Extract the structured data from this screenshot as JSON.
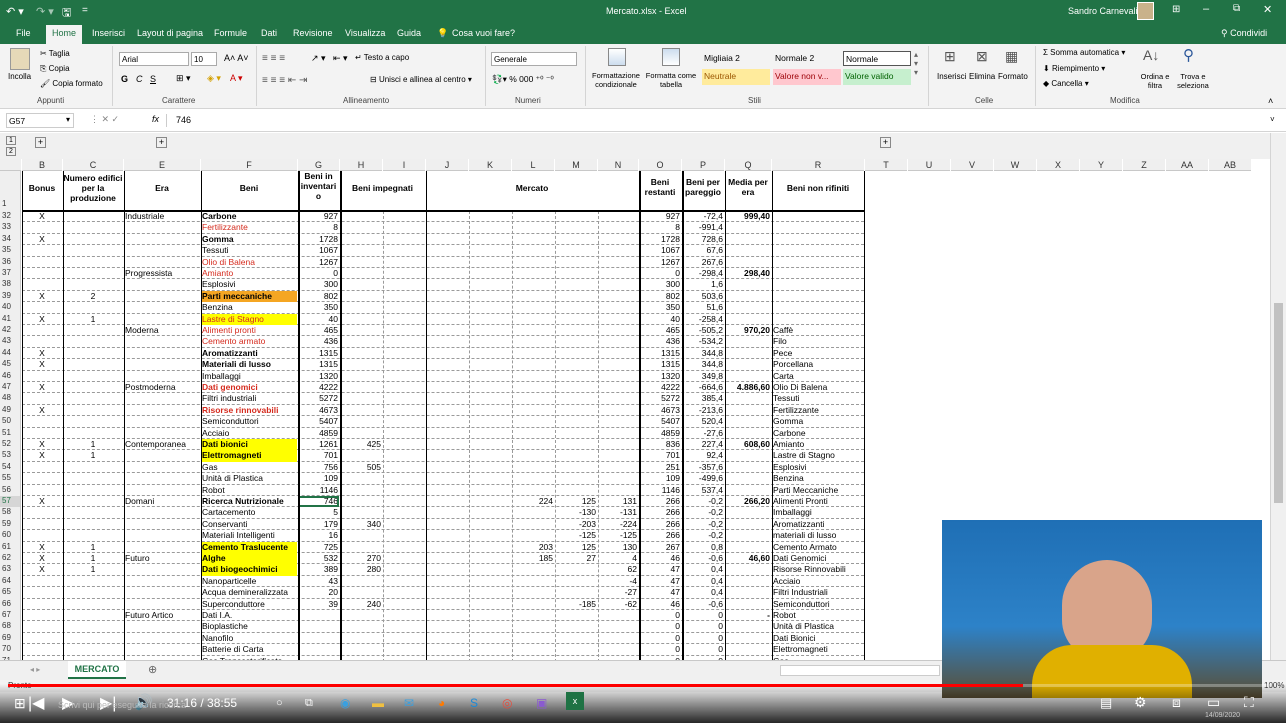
{
  "window": {
    "title": "Mercato.xlsx - Excel",
    "user": "Sandro Carnevali"
  },
  "tabs": [
    "File",
    "Home",
    "Inserisci",
    "Layout di pagina",
    "Formule",
    "Dati",
    "Revisione",
    "Visualizza",
    "Guida",
    "Cosa vuoi fare?"
  ],
  "share": "Condividi",
  "ribbon": {
    "clipboard": {
      "paste": "Incolla",
      "cut": "Taglia",
      "copy": "Copia",
      "format": "Copia formato",
      "label": "Appunti"
    },
    "font": {
      "name": "Arial",
      "size": "10",
      "bold": "G",
      "italic": "C",
      "underline": "S",
      "label": "Carattere"
    },
    "align": {
      "wrap": "Testo a capo",
      "merge": "Unisci e allinea al centro",
      "label": "Allineamento"
    },
    "number": {
      "format": "Generale",
      "label": "Numeri"
    },
    "styles": {
      "cond": "Formattazione condizionale",
      "table": "Formatta come tabella",
      "s1": "Migliaia 2",
      "s2": "Normale 2",
      "s3": "Normale",
      "s4": "Neutrale",
      "s5": "Valore non v...",
      "s6": "Valore valido",
      "label": "Stili"
    },
    "cells": {
      "insert": "Inserisci",
      "delete": "Elimina",
      "format": "Formato",
      "label": "Celle"
    },
    "edit": {
      "autosum": "Somma automatica",
      "fill": "Riempimento",
      "clear": "Cancella",
      "sort": "Ordina e filtra",
      "find": "Trova e seleziona",
      "label": "Modifica"
    }
  },
  "formula": {
    "namebox": "G57",
    "fx": "fx",
    "value": "746"
  },
  "columns": [
    "B",
    "C",
    "E",
    "F",
    "G",
    "H",
    "I",
    "J",
    "K",
    "L",
    "M",
    "N",
    "O",
    "P",
    "Q",
    "R",
    "T",
    "U",
    "V",
    "W",
    "X",
    "Y",
    "Z",
    "AA",
    "AB"
  ],
  "headers": {
    "bonus": "Bonus",
    "edifici": "Numero edifici per la produzione",
    "era": "Era",
    "beni": "Beni",
    "inventario": "Beni in inventari o",
    "impegnati": "Beni impegnati",
    "mercato": "Mercato",
    "restanti": "Beni restanti",
    "pareggio": "Beni per pareggio",
    "media": "Media per era",
    "nonraff": "Beni non rifiniti"
  },
  "rows": [
    {
      "n": "32",
      "b": "X",
      "c": "",
      "e": "Industriale",
      "f": "Carbone",
      "fs": "b",
      "g": "927",
      "h": "",
      "l": "",
      "m": "",
      "nn": "",
      "o": "927",
      "p": "-72,4",
      "q": "999,40",
      "r": ""
    },
    {
      "n": "33",
      "b": "",
      "c": "",
      "e": "",
      "f": "Fertilizzante",
      "fs": "r",
      "g": "8",
      "h": "",
      "l": "",
      "m": "",
      "nn": "",
      "o": "8",
      "p": "-991,4",
      "q": "",
      "r": ""
    },
    {
      "n": "34",
      "b": "X",
      "c": "",
      "e": "",
      "f": "Gomma",
      "fs": "b",
      "g": "1728",
      "h": "",
      "l": "",
      "m": "",
      "nn": "",
      "o": "1728",
      "p": "728,6",
      "q": "",
      "r": ""
    },
    {
      "n": "35",
      "b": "",
      "c": "",
      "e": "",
      "f": "Tessuti",
      "fs": "",
      "g": "1067",
      "h": "",
      "l": "",
      "m": "",
      "nn": "",
      "o": "1067",
      "p": "67,6",
      "q": "",
      "r": ""
    },
    {
      "n": "36",
      "b": "",
      "c": "",
      "e": "",
      "f": "Olio di Balena",
      "fs": "r",
      "g": "1267",
      "h": "",
      "l": "",
      "m": "",
      "nn": "",
      "o": "1267",
      "p": "267,6",
      "q": "",
      "r": ""
    },
    {
      "n": "37",
      "b": "",
      "c": "",
      "e": "Progressista",
      "f": "Amianto",
      "fs": "r",
      "g": "0",
      "h": "",
      "l": "",
      "m": "",
      "nn": "",
      "o": "0",
      "p": "-298,4",
      "q": "298,40",
      "r": ""
    },
    {
      "n": "38",
      "b": "",
      "c": "",
      "e": "",
      "f": "Esplosivi",
      "fs": "",
      "g": "300",
      "h": "",
      "l": "",
      "m": "",
      "nn": "",
      "o": "300",
      "p": "1,6",
      "q": "",
      "r": ""
    },
    {
      "n": "39",
      "b": "X",
      "c": "2",
      "e": "",
      "f": "Parti meccaniche",
      "fs": "bo",
      "g": "802",
      "h": "",
      "l": "",
      "m": "",
      "nn": "",
      "o": "802",
      "p": "503,6",
      "q": "",
      "r": ""
    },
    {
      "n": "40",
      "b": "",
      "c": "",
      "e": "",
      "f": "Benzina",
      "fs": "",
      "g": "350",
      "h": "",
      "l": "",
      "m": "",
      "nn": "",
      "o": "350",
      "p": "51,6",
      "q": "",
      "r": ""
    },
    {
      "n": "41",
      "b": "X",
      "c": "1",
      "e": "",
      "f": "Lastre di Stagno",
      "fs": "ry",
      "g": "40",
      "h": "",
      "l": "",
      "m": "",
      "nn": "",
      "o": "40",
      "p": "-258,4",
      "q": "",
      "r": ""
    },
    {
      "n": "42",
      "b": "",
      "c": "",
      "e": "Moderna",
      "f": "Alimenti pronti",
      "fs": "r",
      "g": "465",
      "h": "",
      "l": "",
      "m": "",
      "nn": "",
      "o": "465",
      "p": "-505,2",
      "q": "970,20",
      "r": "Caffè"
    },
    {
      "n": "43",
      "b": "",
      "c": "",
      "e": "",
      "f": "Cemento armato",
      "fs": "r",
      "g": "436",
      "h": "",
      "l": "",
      "m": "",
      "nn": "",
      "o": "436",
      "p": "-534,2",
      "q": "",
      "r": "Filo"
    },
    {
      "n": "44",
      "b": "X",
      "c": "",
      "e": "",
      "f": "Aromatizzanti",
      "fs": "b",
      "g": "1315",
      "h": "",
      "l": "",
      "m": "",
      "nn": "",
      "o": "1315",
      "p": "344,8",
      "q": "",
      "r": "Pece"
    },
    {
      "n": "45",
      "b": "X",
      "c": "",
      "e": "",
      "f": "Materiali di lusso",
      "fs": "b",
      "g": "1315",
      "h": "",
      "l": "",
      "m": "",
      "nn": "",
      "o": "1315",
      "p": "344,8",
      "q": "",
      "r": "Porcellana"
    },
    {
      "n": "46",
      "b": "",
      "c": "",
      "e": "",
      "f": "Imballaggi",
      "fs": "",
      "g": "1320",
      "h": "",
      "l": "",
      "m": "",
      "nn": "",
      "o": "1320",
      "p": "349,8",
      "q": "",
      "r": "Carta"
    },
    {
      "n": "47",
      "b": "X",
      "c": "",
      "e": "Postmoderna",
      "f": "Dati genomici",
      "fs": "rb",
      "g": "4222",
      "h": "",
      "l": "",
      "m": "",
      "nn": "",
      "o": "4222",
      "p": "-664,6",
      "q": "4.886,60",
      "r": "Olio Di Balena"
    },
    {
      "n": "48",
      "b": "",
      "c": "",
      "e": "",
      "f": "Filtri industriali",
      "fs": "",
      "g": "5272",
      "h": "",
      "l": "",
      "m": "",
      "nn": "",
      "o": "5272",
      "p": "385,4",
      "q": "",
      "r": "Tessuti"
    },
    {
      "n": "49",
      "b": "X",
      "c": "",
      "e": "",
      "f": "Risorse rinnovabili",
      "fs": "rb",
      "g": "4673",
      "h": "",
      "l": "",
      "m": "",
      "nn": "",
      "o": "4673",
      "p": "-213,6",
      "q": "",
      "r": "Fertilizzante"
    },
    {
      "n": "50",
      "b": "",
      "c": "",
      "e": "",
      "f": "Semiconduttori",
      "fs": "",
      "g": "5407",
      "h": "",
      "l": "",
      "m": "",
      "nn": "",
      "o": "5407",
      "p": "520,4",
      "q": "",
      "r": "Gomma"
    },
    {
      "n": "51",
      "b": "",
      "c": "",
      "e": "",
      "f": "Acciaio",
      "fs": "",
      "g": "4859",
      "h": "",
      "l": "",
      "m": "",
      "nn": "",
      "o": "4859",
      "p": "-27,6",
      "q": "",
      "r": "Carbone"
    },
    {
      "n": "52",
      "b": "X",
      "c": "1",
      "e": "Contemporanea",
      "f": "Dati bionici",
      "fs": "by",
      "g": "1261",
      "h": "425",
      "l": "",
      "m": "",
      "nn": "",
      "o": "836",
      "p": "227,4",
      "q": "608,60",
      "r": "Amianto"
    },
    {
      "n": "53",
      "b": "X",
      "c": "1",
      "e": "",
      "f": "Elettromagneti",
      "fs": "by",
      "g": "701",
      "h": "",
      "l": "",
      "m": "",
      "nn": "",
      "o": "701",
      "p": "92,4",
      "q": "",
      "r": "Lastre di Stagno"
    },
    {
      "n": "54",
      "b": "",
      "c": "",
      "e": "",
      "f": "Gas",
      "fs": "",
      "g": "756",
      "h": "505",
      "l": "",
      "m": "",
      "nn": "",
      "o": "251",
      "p": "-357,6",
      "q": "",
      "r": "Esplosivi"
    },
    {
      "n": "55",
      "b": "",
      "c": "",
      "e": "",
      "f": "Unità di Plastica",
      "fs": "",
      "g": "109",
      "h": "",
      "l": "",
      "m": "",
      "nn": "",
      "o": "109",
      "p": "-499,6",
      "q": "",
      "r": "Benzina"
    },
    {
      "n": "56",
      "b": "",
      "c": "",
      "e": "",
      "f": "Robot",
      "fs": "",
      "g": "1146",
      "h": "",
      "l": "",
      "m": "",
      "nn": "",
      "o": "1146",
      "p": "537,4",
      "q": "",
      "r": "Parti Meccaniche"
    },
    {
      "n": "57",
      "b": "X",
      "c": "",
      "e": "Domani",
      "f": "Ricerca Nutrizionale",
      "fs": "b",
      "g": "746",
      "h": "",
      "l": "224",
      "m": "125",
      "nn": "131",
      "o": "266",
      "p": "-0,2",
      "q": "266,20",
      "r": "Alimenti Pronti"
    },
    {
      "n": "58",
      "b": "",
      "c": "",
      "e": "",
      "f": "Cartacemento",
      "fs": "",
      "g": "5",
      "h": "",
      "l": "",
      "m": "-130",
      "nn": "-131",
      "o": "266",
      "p": "-0,2",
      "q": "",
      "r": "Imballaggi"
    },
    {
      "n": "59",
      "b": "",
      "c": "",
      "e": "",
      "f": "Conservanti",
      "fs": "",
      "g": "179",
      "h": "340",
      "l": "",
      "m": "-203",
      "nn": "-224",
      "o": "266",
      "p": "-0,2",
      "q": "",
      "r": "Aromatizzanti"
    },
    {
      "n": "60",
      "b": "",
      "c": "",
      "e": "",
      "f": "Materiali Intelligenti",
      "fs": "",
      "g": "16",
      "h": "",
      "l": "",
      "m": "-125",
      "nn": "-125",
      "o": "266",
      "p": "-0,2",
      "q": "",
      "r": "materiali di lusso"
    },
    {
      "n": "61",
      "b": "X",
      "c": "1",
      "e": "",
      "f": "Cemento Traslucente",
      "fs": "by",
      "g": "725",
      "h": "",
      "l": "203",
      "m": "125",
      "nn": "130",
      "o": "267",
      "p": "0,8",
      "q": "",
      "r": "Cemento Armato"
    },
    {
      "n": "62",
      "b": "X",
      "c": "1",
      "e": "Futuro",
      "f": "Alghe",
      "fs": "by",
      "g": "532",
      "h": "270",
      "l": "185",
      "m": "27",
      "nn": "4",
      "o": "46",
      "p": "-0,6",
      "q": "46,60",
      "r": "Dati Genomici"
    },
    {
      "n": "63",
      "b": "X",
      "c": "1",
      "e": "",
      "f": "Dati biogeochimici",
      "fs": "by",
      "g": "389",
      "h": "280",
      "l": "",
      "m": "",
      "nn": "62",
      "o": "47",
      "p": "0,4",
      "q": "",
      "r": "Risorse Rinnovabili"
    },
    {
      "n": "64",
      "b": "",
      "c": "",
      "e": "",
      "f": "Nanoparticelle",
      "fs": "",
      "g": "43",
      "h": "",
      "l": "",
      "m": "",
      "nn": "-4",
      "o": "47",
      "p": "0,4",
      "q": "",
      "r": "Acciaio"
    },
    {
      "n": "65",
      "b": "",
      "c": "",
      "e": "",
      "f": "Acqua demineralizzata",
      "fs": "",
      "g": "20",
      "h": "",
      "l": "",
      "m": "",
      "nn": "-27",
      "o": "47",
      "p": "0,4",
      "q": "",
      "r": "Filtri Industriali"
    },
    {
      "n": "66",
      "b": "",
      "c": "",
      "e": "",
      "f": "Superconduttore",
      "fs": "",
      "g": "39",
      "h": "240",
      "l": "",
      "m": "-185",
      "nn": "-62",
      "o": "46",
      "p": "-0,6",
      "q": "",
      "r": "Semiconduttori"
    },
    {
      "n": "67",
      "b": "",
      "c": "",
      "e": "Futuro Artico",
      "f": "Dati I.A.",
      "fs": "",
      "g": "",
      "h": "",
      "l": "",
      "m": "",
      "nn": "",
      "o": "0",
      "p": "0",
      "q": "-",
      "r": "Robot"
    },
    {
      "n": "68",
      "b": "",
      "c": "",
      "e": "",
      "f": "Bioplastiche",
      "fs": "",
      "g": "",
      "h": "",
      "l": "",
      "m": "",
      "nn": "",
      "o": "0",
      "p": "0",
      "q": "",
      "r": "Unità di Plastica"
    },
    {
      "n": "69",
      "b": "",
      "c": "",
      "e": "",
      "f": "Nanofilo",
      "fs": "",
      "g": "",
      "h": "",
      "l": "",
      "m": "",
      "nn": "",
      "o": "0",
      "p": "0",
      "q": "",
      "r": "Dati Bionici"
    },
    {
      "n": "70",
      "b": "",
      "c": "",
      "e": "",
      "f": "Batterie di Carta",
      "fs": "",
      "g": "",
      "h": "",
      "l": "",
      "m": "",
      "nn": "",
      "o": "0",
      "p": "0",
      "q": "",
      "r": "Elettromagneti"
    },
    {
      "n": "71",
      "b": "",
      "c": "",
      "e": "",
      "f": "Gas Transesterificato",
      "fs": "",
      "g": "",
      "h": "",
      "l": "",
      "m": "",
      "nn": "",
      "o": "0",
      "p": "0",
      "q": "",
      "r": "Gas"
    }
  ],
  "sheet": {
    "tab": "MERCATO",
    "status": "Pronto",
    "zoom": "100%"
  },
  "player": {
    "time": "31:16 / 38:55",
    "progress": 0.804
  },
  "taskbar": {
    "search": "Scrivi qui per eseguire la ricerca",
    "date": "14/09/2020"
  }
}
